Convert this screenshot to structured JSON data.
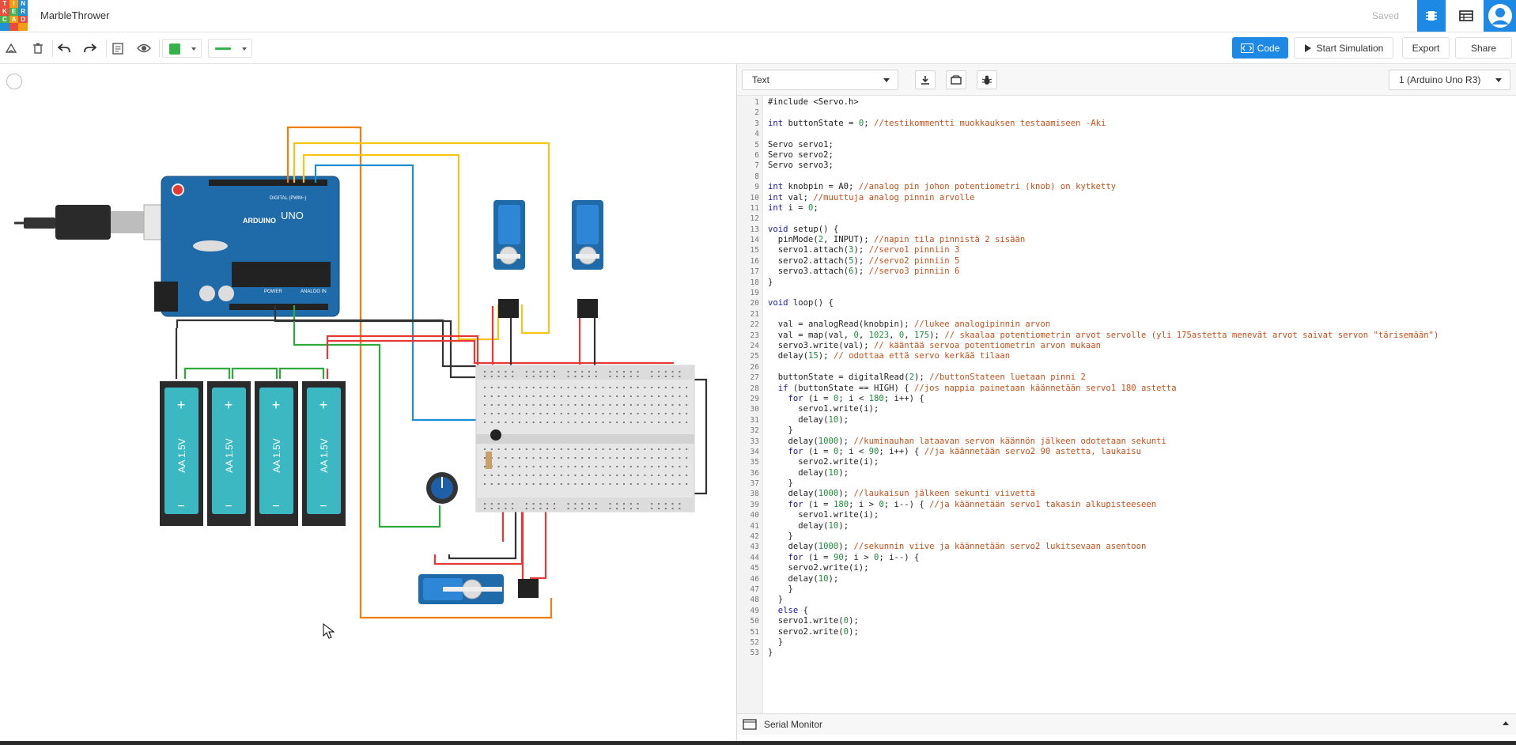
{
  "app": {
    "project_title": "MarbleThrower",
    "status": "Saved",
    "logo_letters": [
      "T",
      "I",
      "N",
      "K",
      "E",
      "R",
      "C",
      "A",
      "D"
    ],
    "logo_colors": [
      "#e84c3d",
      "#f39c12",
      "#1f8fd6",
      "#e84c3d",
      "#4caf50",
      "#1f8fd6",
      "#4caf50",
      "#f39c12",
      "#e84c3d"
    ]
  },
  "toolbar": {
    "tools": [
      "rotate-icon",
      "delete-icon",
      "undo-icon",
      "redo-icon",
      "notes-icon",
      "visibility-icon"
    ],
    "fill_color": "#35b34a",
    "wire_color": "#35b34a",
    "code_label": "Code",
    "start_label": "Start Simulation",
    "export_label": "Export",
    "share_label": "Share"
  },
  "editor": {
    "mode": "Text",
    "board": "1 (Arduino Uno R3)",
    "serial_label": "Serial Monitor",
    "lines": [
      "#include <Servo.h>",
      "",
      "int buttonState = 0; //testikommentti muokkauksen testaamiseen -Aki",
      "",
      "Servo servo1;",
      "Servo servo2;",
      "Servo servo3;",
      "",
      "int knobpin = A0; //analog pin johon potentiometri (knob) on kytketty",
      "int val; //muuttuja analog pinnin arvolle",
      "int i = 0;",
      "",
      "void setup() {",
      "  pinMode(2, INPUT); //napin tila pinnistä 2 sisään",
      "  servo1.attach(3); //servo1 pinniin 3",
      "  servo2.attach(5); //servo2 pinniin 5",
      "  servo3.attach(6); //servo3 pinniin 6",
      "}",
      "",
      "void loop() {",
      "",
      "  val = analogRead(knobpin); //lukee analogipinnin arvon",
      "  val = map(val, 0, 1023, 0, 175); // skaalaa potentiometrin arvot servolle (yli 175astetta menevät arvot saivat servon \"tärisemään\")",
      "  servo3.write(val); // kääntää servoa potentiometrin arvon mukaan",
      "  delay(15); // odottaa että servo kerkää tilaan",
      "",
      "  buttonState = digitalRead(2); //buttonStateen luetaan pinni 2",
      "  if (buttonState == HIGH) { //jos nappia painetaan käännetään servo1 180 astetta",
      "    for (i = 0; i < 180; i++) {",
      "      servo1.write(i);",
      "      delay(10);",
      "    }",
      "    delay(1000); //kuminauhan lataavan servon käännön jälkeen odotetaan sekunti",
      "    for (i = 0; i < 90; i++) { //ja käännetään servo2 90 astetta, laukaisu",
      "      servo2.write(i);",
      "      delay(10);",
      "    }",
      "    delay(1000); //laukaisun jälkeen sekunti viivettä",
      "    for (i = 180; i > 0; i--) { //ja käännetään servo1 takasin alkupisteeseen",
      "      servo1.write(i);",
      "      delay(10);",
      "    }",
      "    delay(1000); //sekunnin viive ja käännetään servo2 lukitsevaan asentoon",
      "    for (i = 90; i > 0; i--) {",
      "    servo2.write(i);",
      "    delay(10);",
      "    }",
      "  }",
      "  else {",
      "  servo1.write(0);",
      "  servo2.write(0);",
      "  }",
      "}"
    ]
  },
  "circuit": {
    "arduino_logo": "ARDUINO",
    "arduino_model": "UNO",
    "arduino_digital": "DIGITAL (PWM~)",
    "arduino_power": "POWER",
    "arduino_analog": "ANALOG IN",
    "battery_label": "AA 1.5V",
    "battery_plus": "+",
    "battery_minus": "−"
  }
}
